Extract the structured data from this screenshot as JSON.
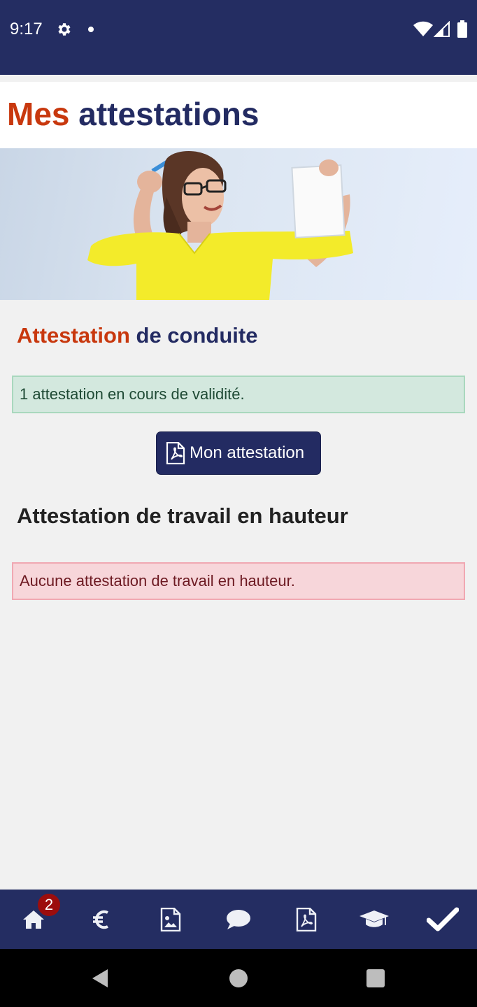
{
  "status_bar": {
    "time": "9:17",
    "icons": [
      "gear-icon",
      "notification-dot",
      "wifi-icon",
      "signal-icon",
      "battery-icon"
    ]
  },
  "header": {
    "title_accent": "Mes",
    "title_main": "attestations"
  },
  "banner": {
    "image": "woman-holding-paper-photo"
  },
  "conduite": {
    "heading_accent": "Attestation",
    "heading_main": "de conduite",
    "status_text": "1 attestation en cours de validité.",
    "button_label": "Mon attestation",
    "button_icon": "pdf-file-icon"
  },
  "hauteur": {
    "heading": "Attestation de travail en hauteur",
    "status_text": "Aucune attestation de travail en hauteur."
  },
  "bottom_nav": {
    "badge_count": "2",
    "items": [
      {
        "icon": "home-icon"
      },
      {
        "icon": "euro-icon"
      },
      {
        "icon": "image-file-icon"
      },
      {
        "icon": "chat-icon"
      },
      {
        "icon": "pdf-file-icon"
      },
      {
        "icon": "graduation-cap-icon"
      },
      {
        "icon": "checkmark-icon"
      }
    ]
  },
  "system_nav": {
    "items": [
      "back-icon",
      "home-circle-icon",
      "recents-icon"
    ]
  },
  "colors": {
    "navy": "#242d62",
    "accent": "#c8380e",
    "success_bg": "#d3e8de",
    "danger_bg": "#f7d6da"
  }
}
